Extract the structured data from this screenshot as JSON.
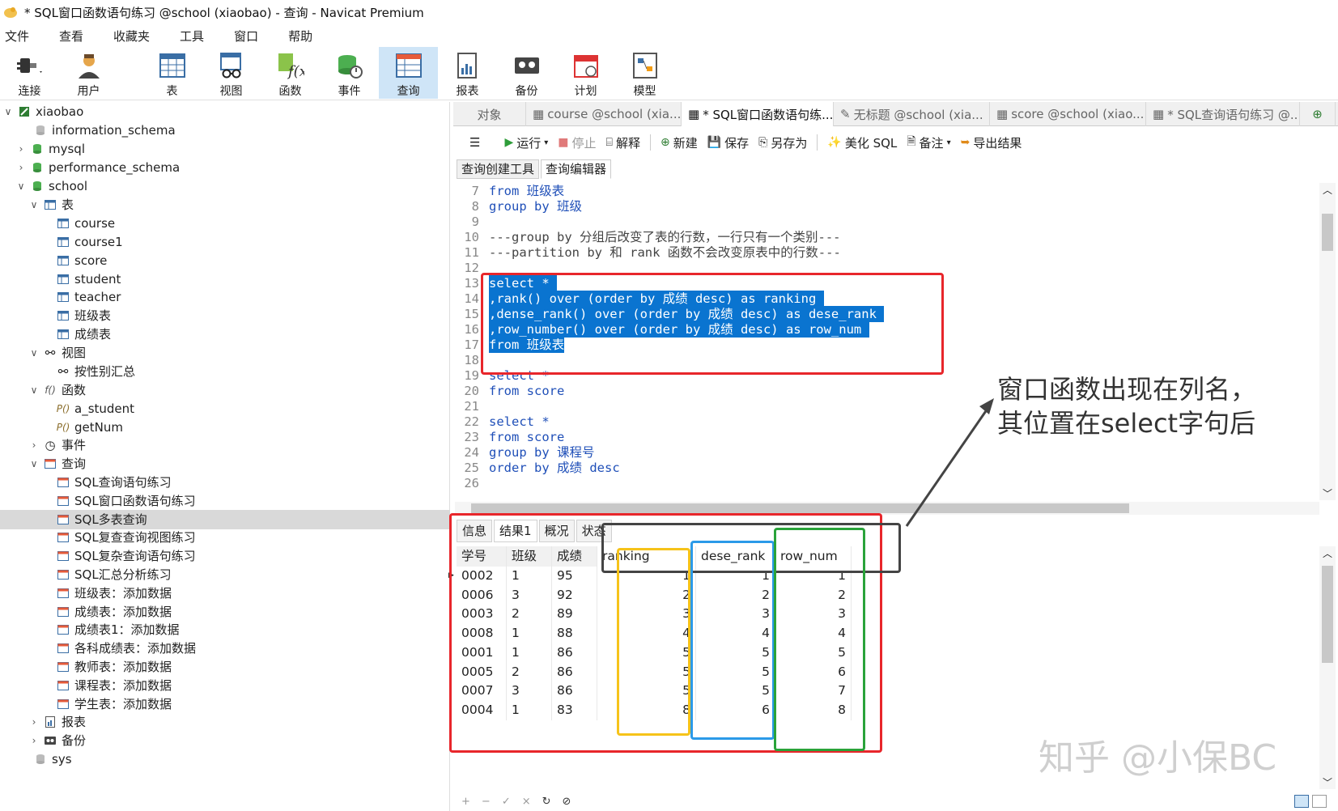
{
  "window": {
    "title": "* SQL窗口函数语句练习 @school (xiaobao) - 查询 - Navicat Premium"
  },
  "menu": [
    "文件",
    "查看",
    "收藏夹",
    "工具",
    "窗口",
    "帮助"
  ],
  "toolbar": [
    "连接",
    "用户",
    "表",
    "视图",
    "函数",
    "事件",
    "查询",
    "报表",
    "备份",
    "计划",
    "模型"
  ],
  "tree": {
    "root": "xiaobao",
    "dbs": [
      "information_schema",
      "mysql",
      "performance_schema",
      "school"
    ],
    "tables_label": "表",
    "tables": [
      "course",
      "course1",
      "score",
      "student",
      "teacher",
      "班级表",
      "成绩表"
    ],
    "views_label": "视图",
    "views": [
      "按性别汇总"
    ],
    "functions_label": "函数",
    "functions": [
      "a_student",
      "getNum"
    ],
    "events_label": "事件",
    "queries_label": "查询",
    "queries": [
      "SQL查询语句练习",
      "SQL窗口函数语句练习",
      "SQL多表查询",
      "SQL复查查询视图练习",
      "SQL复杂查询语句练习",
      "SQL汇总分析练习",
      "班级表：添加数据",
      "成绩表：添加数据",
      "成绩表1：添加数据",
      "各科成绩表：添加数据",
      "教师表：添加数据",
      "课程表：添加数据",
      "学生表：添加数据"
    ],
    "reports_label": "报表",
    "backup_label": "备份",
    "sys": "sys"
  },
  "tabs": [
    "对象",
    "course @school (xia...",
    "* SQL窗口函数语句练...",
    "无标题 @school (xia...",
    "score @school (xiao...",
    "* SQL查询语句练习 @..."
  ],
  "query_toolbar": {
    "menu": "☰",
    "run": "运行",
    "stop": "停止",
    "explain": "解释",
    "new": "新建",
    "save": "保存",
    "save_as": "另存为",
    "beautify": "美化 SQL",
    "note": "备注",
    "export": "导出结果"
  },
  "subtabs": [
    "查询创建工具",
    "查询编辑器"
  ],
  "editor": {
    "lines": [
      {
        "no": "7",
        "code": "from 班级表"
      },
      {
        "no": "8",
        "code": "group by 班级"
      },
      {
        "no": "9",
        "code": ""
      },
      {
        "no": "10",
        "code": "---group by 分组后改变了表的行数，一行只有一个类别---"
      },
      {
        "no": "11",
        "code": "---partition by 和 rank 函数不会改变原表中的行数---"
      },
      {
        "no": "12",
        "code": ""
      },
      {
        "no": "13",
        "code": "select * "
      },
      {
        "no": "14",
        "code": ",rank() over (order by 成绩 desc) as ranking "
      },
      {
        "no": "15",
        "code": ",dense_rank() over (order by 成绩 desc) as dese_rank "
      },
      {
        "no": "16",
        "code": ",row_number() over (order by 成绩 desc) as row_num "
      },
      {
        "no": "17",
        "code": "from 班级表"
      },
      {
        "no": "18",
        "code": ""
      },
      {
        "no": "19",
        "code": "select *"
      },
      {
        "no": "20",
        "code": "from score"
      },
      {
        "no": "21",
        "code": ""
      },
      {
        "no": "22",
        "code": "select *"
      },
      {
        "no": "23",
        "code": "from score"
      },
      {
        "no": "24",
        "code": "group by 课程号"
      },
      {
        "no": "25",
        "code": "order by 成绩 desc"
      },
      {
        "no": "26",
        "code": ""
      }
    ]
  },
  "result_tabs": [
    "信息",
    "结果1",
    "概况",
    "状态"
  ],
  "grid": {
    "columns": [
      "学号",
      "班级",
      "成绩",
      "ranking",
      "dese_rank",
      "row_num"
    ],
    "rows": [
      [
        "0002",
        "1",
        "95",
        "1",
        "1",
        "1"
      ],
      [
        "0006",
        "3",
        "92",
        "2",
        "2",
        "2"
      ],
      [
        "0003",
        "2",
        "89",
        "3",
        "3",
        "3"
      ],
      [
        "0008",
        "1",
        "88",
        "4",
        "4",
        "4"
      ],
      [
        "0001",
        "1",
        "86",
        "5",
        "5",
        "5"
      ],
      [
        "0005",
        "2",
        "86",
        "5",
        "5",
        "6"
      ],
      [
        "0007",
        "3",
        "86",
        "5",
        "5",
        "7"
      ],
      [
        "0004",
        "1",
        "83",
        "8",
        "6",
        "8"
      ]
    ]
  },
  "callout": {
    "line1": "窗口函数出现在列名，",
    "line2": "其位置在select字句后"
  },
  "watermark": "知乎 @小保BC",
  "bottom_icons": [
    "+",
    "−",
    "✓",
    "×",
    "↻",
    "⊘"
  ],
  "colors": {
    "selection": "#0a74d0",
    "red_box": "#e8262b",
    "yellow_box": "#f6c31a",
    "blue_box": "#2b9ae8",
    "green_box": "#2aa33a",
    "black_box": "#444444"
  }
}
